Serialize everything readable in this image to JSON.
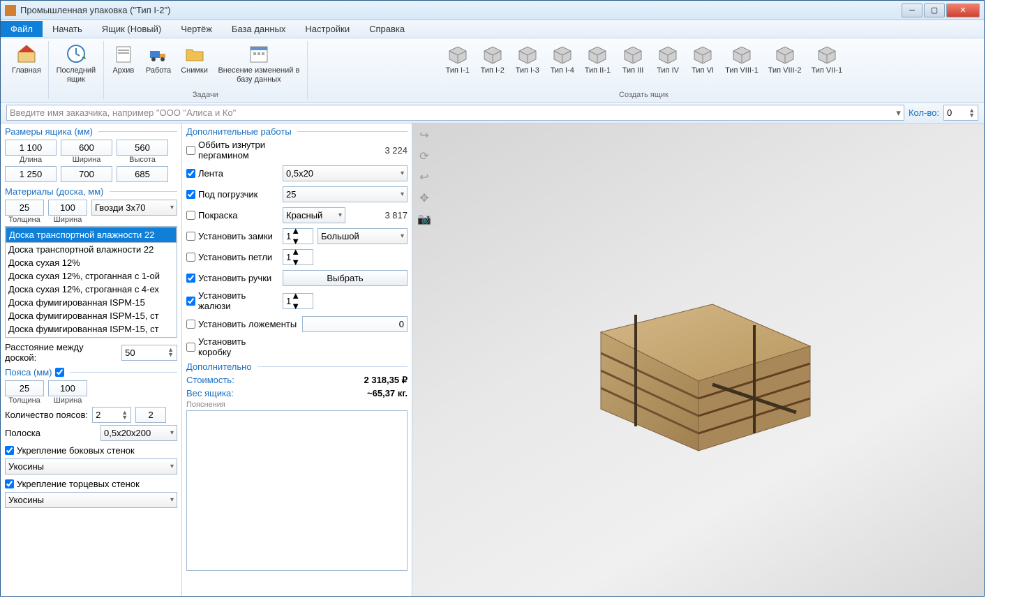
{
  "title": "Промышленная упаковка (\"Тип I-2\")",
  "menu": {
    "file": "Файл",
    "start": "Начать",
    "crate": "Ящик (Новый)",
    "drawing": "Чертёж",
    "db": "База данных",
    "settings": "Настройки",
    "help": "Справка"
  },
  "ribbon": {
    "home": "Главная",
    "last": "Последний\nящик",
    "archive": "Архив",
    "work": "Работа",
    "snaps": "Снимки",
    "dbedit": "Внесение изменений в\nбазу данных",
    "tasks": "Задачи",
    "create": "Создать ящик",
    "types": [
      "Тип I-1",
      "Тип I-2",
      "Тип I-3",
      "Тип I-4",
      "Тип II-1",
      "Тип III",
      "Тип IV",
      "Тип VI",
      "Тип VIII-1",
      "Тип VIII-2",
      "Тип VII-1"
    ]
  },
  "customer_placeholder": "Введите имя заказчика, например \"ООО \"Алиса и Ко\"",
  "qty_label": "Кол-во:",
  "qty": "0",
  "dims": {
    "legend": "Размеры ящика (мм)",
    "len_lbl": "Длина",
    "wid_lbl": "Ширина",
    "hgt_lbl": "Высота",
    "len": "1 100",
    "wid": "600",
    "hgt": "560",
    "len2": "1 250",
    "wid2": "700",
    "hgt2": "685"
  },
  "mat": {
    "legend": "Материалы (доска, мм)",
    "th": "25",
    "w": "100",
    "nails": "Гвозди 3x70",
    "th_lbl": "Толщина",
    "w_lbl": "Ширина",
    "items": [
      "Доска транспортной влажности 22",
      "Доска транспортной влажности 22",
      "Доска сухая 12%",
      "Доска сухая 12%, строганная с 1-ой",
      "Доска сухая 12%, строганная с 4-ех",
      "Доска фумигированная ISPM-15",
      "Доска фумигированная ISPM-15, ст",
      "Доска фумигированная ISPM-15, ст"
    ]
  },
  "gap": {
    "lbl": "Расстояние между доской:",
    "val": "50"
  },
  "belts": {
    "legend": "Пояса (мм)",
    "th": "25",
    "w": "100",
    "th_lbl": "Толщина",
    "w_lbl": "Ширина",
    "cnt_lbl": "Количество поясов:",
    "cnt1": "2",
    "cnt2": "2",
    "strip_lbl": "Полоска",
    "strip": "0,5x20x200"
  },
  "reinf": {
    "side": "Укрепление боковых стенок",
    "end": "Укрепление торцевых стенок",
    "opt": "Укосины"
  },
  "extra": {
    "legend": "Дополнительные работы",
    "add_legend": "Дополнительно",
    "pergamin": "Оббить изнутри пергамином",
    "pergamin_v": "3 224",
    "tape": "Лента",
    "tape_v": "0,5x20",
    "fork": "Под погрузчик",
    "fork_v": "25",
    "paint": "Покраска",
    "paint_v": "Красный",
    "paint_p": "3 817",
    "locks": "Установить замки",
    "locks_n": "1",
    "locks_sz": "Большой",
    "hinges": "Установить петли",
    "hinges_n": "1",
    "handles": "Установить ручки",
    "choose": "Выбрать",
    "blinds": "Установить жалюзи",
    "blinds_n": "1",
    "cradles": "Установить ложементы",
    "cradles_v": "0",
    "box": "Установить коробку",
    "cost_lbl": "Стоимость:",
    "cost": "2 318,35 ₽",
    "weight_lbl": "Вес ящика:",
    "weight": "~65,37 кг.",
    "notes": "Пояснения"
  }
}
